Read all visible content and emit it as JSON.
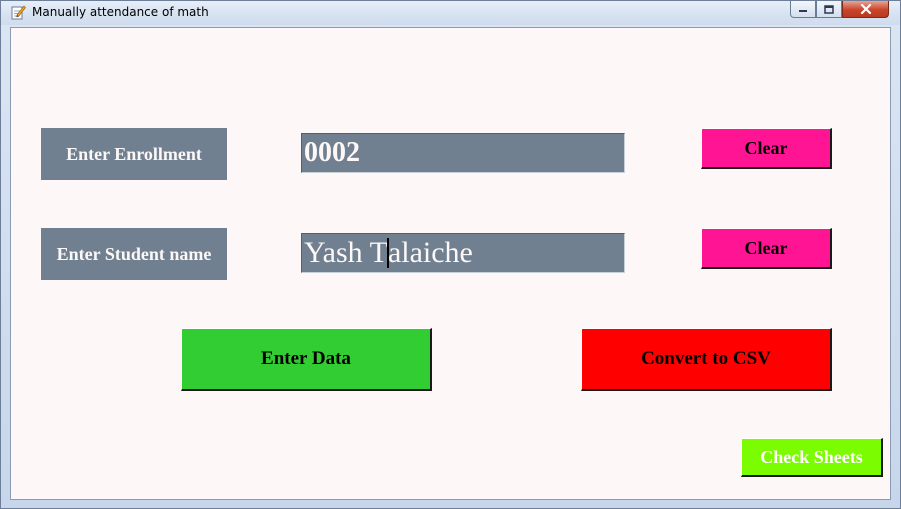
{
  "window": {
    "title": "Manually attendance of math",
    "icon": "notepad-pencil-icon"
  },
  "form": {
    "enrollment_label": "Enter Enrollment",
    "enrollment_value": "0002",
    "name_label": "Enter Student name",
    "name_value_before_caret": "Yash T",
    "name_value_after_caret": "alaiche",
    "clear_label_1": "Clear",
    "clear_label_2": "Clear",
    "enter_data_label": "Enter Data",
    "convert_label": "Convert to CSV",
    "check_sheets_label": "Check Sheets"
  },
  "colors": {
    "label_bg": "#708090",
    "clear_bg": "#ff1493",
    "enter_data_bg": "#32cd32",
    "convert_bg": "#ff0000",
    "check_sheets_bg": "#7cfc00",
    "client_bg": "#fdf8f7"
  }
}
